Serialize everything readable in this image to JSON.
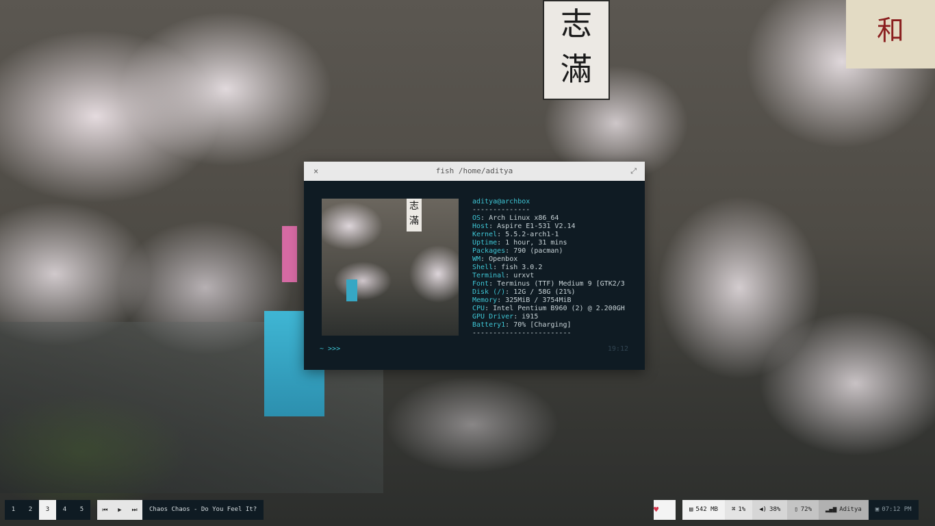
{
  "terminal": {
    "title": "fish /home/aditya",
    "close_glyph": "×",
    "maximize_glyph": "⤢",
    "user_host": "aditya@archbox",
    "underline": "--------------",
    "info": [
      {
        "key": "OS",
        "value": "Arch Linux x86_64"
      },
      {
        "key": "Host",
        "value": "Aspire E1-531 V2.14"
      },
      {
        "key": "Kernel",
        "value": "5.5.2-arch1-1"
      },
      {
        "key": "Uptime",
        "value": "1 hour, 31 mins"
      },
      {
        "key": "Packages",
        "value": "790 (pacman)"
      },
      {
        "key": "WM",
        "value": "Openbox"
      },
      {
        "key": "Shell",
        "value": "fish 3.0.2"
      },
      {
        "key": "Terminal",
        "value": "urxvt"
      },
      {
        "key": "Font",
        "value": "Terminus (TTF) Medium 9 [GTK2/3"
      },
      {
        "key": "Disk (/)",
        "value": "12G / 58G (21%)"
      },
      {
        "key": "Memory",
        "value": "325MiB / 3754MiB"
      },
      {
        "key": "CPU",
        "value": "Intel Pentium B960 (2) @ 2.200GH"
      },
      {
        "key": "GPU Driver",
        "value": "i915"
      },
      {
        "key": "Battery1",
        "value": "70% [Charging]"
      }
    ],
    "footer_line": "------------------------",
    "prompt": "~ >>>",
    "time": "19:12"
  },
  "workspaces": {
    "items": [
      "1",
      "2",
      "3",
      "4",
      "5"
    ],
    "active": "3"
  },
  "media": {
    "prev": "⏮",
    "play": "▶",
    "next": "⏭",
    "song": "Chaos Chaos - Do You Feel It?"
  },
  "status": {
    "heart": "♥",
    "memory": {
      "icon": "memory-icon",
      "value": "542 MB"
    },
    "cpu": {
      "icon": "cpu-icon",
      "value": "1%"
    },
    "volume": {
      "icon": "volume-icon",
      "value": "38%"
    },
    "battery": {
      "icon": "battery-icon",
      "value": "72%"
    },
    "network": {
      "icon": "wifi-icon",
      "value": "Aditya"
    },
    "clock": {
      "icon": "calendar-icon",
      "value": "07:12 PM"
    }
  },
  "colors": {
    "terminal_bg": "#0f1b23",
    "accent_cyan": "#3fc7d6",
    "heart_red": "#d5334b"
  }
}
